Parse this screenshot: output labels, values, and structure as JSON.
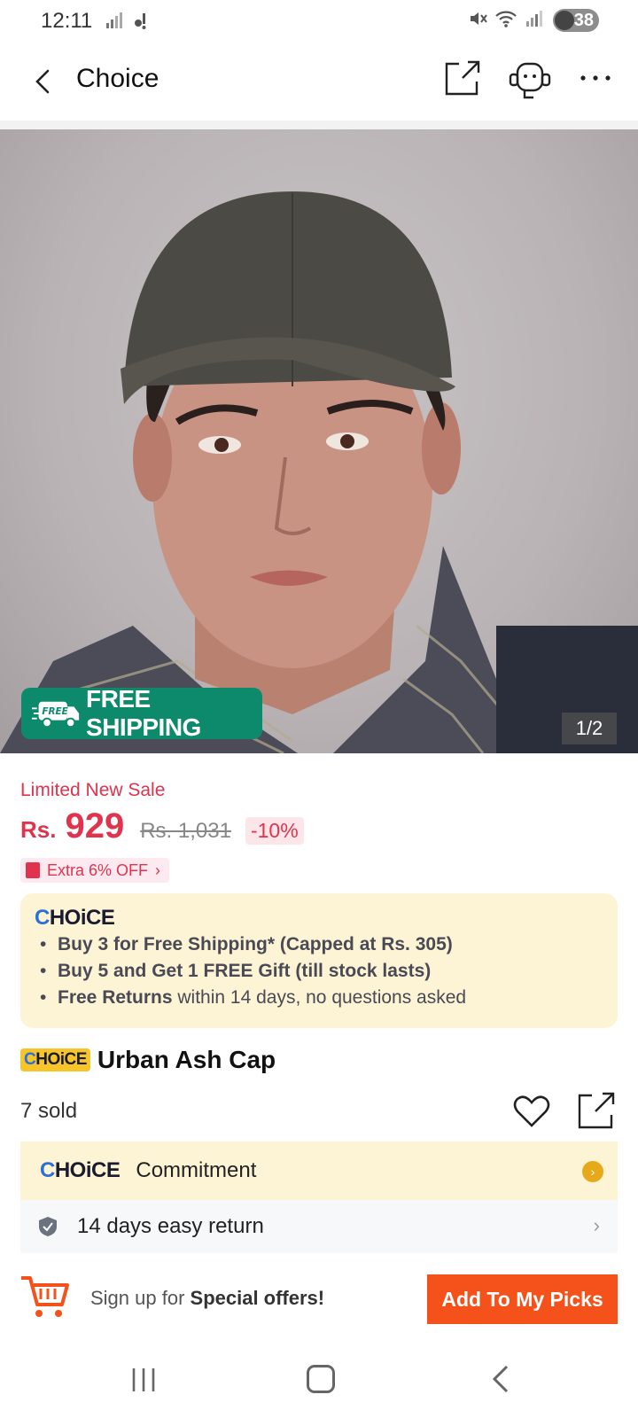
{
  "status_bar": {
    "time": "12:11",
    "battery": "38",
    "left_icons": [
      "signal-icon",
      "notification-icon"
    ],
    "right_icons": [
      "mute-icon",
      "wifi-icon",
      "signal-icon"
    ]
  },
  "nav": {
    "title": "Choice",
    "icons": [
      "back-icon",
      "share-icon",
      "support-icon",
      "more-icon"
    ]
  },
  "product_image": {
    "counter": "1/2",
    "free_shipping_badge": "FREE SHIPPING",
    "truck_label": "FREE"
  },
  "price": {
    "sale_label": "Limited New Sale",
    "currency": "Rs.",
    "current": "929",
    "original": "Rs. 1,031",
    "discount": "-10%",
    "extra_offer": "Extra 6% OFF"
  },
  "choice_card": {
    "logo_first": "C",
    "logo_rest": "HOiCE",
    "benefits": [
      {
        "bold": "Buy 3 for  Free Shipping* (Capped at Rs. 305)",
        "rest": ""
      },
      {
        "bold": "Buy 5 and Get 1 FREE Gift (till stock lasts)",
        "rest": ""
      },
      {
        "bold": "Free Returns",
        "rest": " within 14 days, no questions asked"
      }
    ]
  },
  "product": {
    "tag_first": "C",
    "tag_rest": "HOiCE",
    "title": "Urban Ash Cap",
    "sold": "7 sold"
  },
  "commitment": {
    "logo_first": "C",
    "logo_rest": "HOiCE",
    "label": "Commitment",
    "return_text": "14 days easy return"
  },
  "bottom_bar": {
    "signup_prefix": "Sign up for ",
    "signup_bold": "Special offers!",
    "add_button": "Add To My Picks"
  },
  "colors": {
    "accent_red": "#e0334d",
    "choice_yellow": "#fdf3d5",
    "cta_orange": "#f5511a",
    "free_green": "#0d8a6b"
  }
}
